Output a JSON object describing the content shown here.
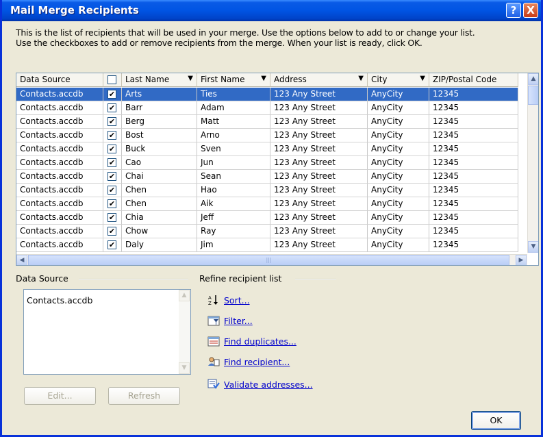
{
  "window": {
    "title": "Mail Merge Recipients",
    "help_label": "?",
    "close_label": "X"
  },
  "intro": {
    "line1": "This is the list of recipients that will be used in your merge.  Use the options below to add to or change your list.",
    "line2": "Use the checkboxes to add or remove recipients from the merge.  When your list is ready, click OK."
  },
  "grid": {
    "columns": [
      "Data Source",
      "",
      "Last Name",
      "First Name",
      "Address",
      "City",
      "ZIP/Postal Code"
    ],
    "rows": [
      {
        "source": "Contacts.accdb",
        "checked": true,
        "last": "Arts",
        "first": "Ties",
        "address": "123 Any Street",
        "city": "AnyCity",
        "zip": "12345",
        "selected": true
      },
      {
        "source": "Contacts.accdb",
        "checked": true,
        "last": "Barr",
        "first": "Adam",
        "address": "123 Any Street",
        "city": "AnyCity",
        "zip": "12345"
      },
      {
        "source": "Contacts.accdb",
        "checked": true,
        "last": "Berg",
        "first": "Matt",
        "address": "123 Any Street",
        "city": "AnyCity",
        "zip": "12345"
      },
      {
        "source": "Contacts.accdb",
        "checked": true,
        "last": "Bost",
        "first": "Arno",
        "address": "123 Any Street",
        "city": "AnyCity",
        "zip": "12345"
      },
      {
        "source": "Contacts.accdb",
        "checked": true,
        "last": "Buck",
        "first": "Sven",
        "address": "123 Any Street",
        "city": "AnyCity",
        "zip": "12345"
      },
      {
        "source": "Contacts.accdb",
        "checked": true,
        "last": "Cao",
        "first": "Jun",
        "address": "123 Any Street",
        "city": "AnyCity",
        "zip": "12345"
      },
      {
        "source": "Contacts.accdb",
        "checked": true,
        "last": "Chai",
        "first": "Sean",
        "address": "123 Any Street",
        "city": "AnyCity",
        "zip": "12345"
      },
      {
        "source": "Contacts.accdb",
        "checked": true,
        "last": "Chen",
        "first": "Hao",
        "address": "123 Any Street",
        "city": "AnyCity",
        "zip": "12345"
      },
      {
        "source": "Contacts.accdb",
        "checked": true,
        "last": "Chen",
        "first": "Aik",
        "address": "123 Any Street",
        "city": "AnyCity",
        "zip": "12345"
      },
      {
        "source": "Contacts.accdb",
        "checked": true,
        "last": "Chia",
        "first": "Jeff",
        "address": "123 Any Street",
        "city": "AnyCity",
        "zip": "12345"
      },
      {
        "source": "Contacts.accdb",
        "checked": true,
        "last": "Chow",
        "first": "Ray",
        "address": "123 Any Street",
        "city": "AnyCity",
        "zip": "12345"
      },
      {
        "source": "Contacts.accdb",
        "checked": true,
        "last": "Daly",
        "first": "Jim",
        "address": "123 Any Street",
        "city": "AnyCity",
        "zip": "12345"
      }
    ]
  },
  "data_source": {
    "group_label": "Data Source",
    "items": [
      "Contacts.accdb"
    ],
    "edit_label": "Edit...",
    "refresh_label": "Refresh"
  },
  "refine": {
    "group_label": "Refine recipient list",
    "sort_label": "Sort...",
    "filter_label": "Filter...",
    "find_duplicates_label": "Find duplicates...",
    "find_recipient_label": "Find recipient...",
    "validate_label": "Validate addresses..."
  },
  "ok_label": "OK",
  "colors": {
    "titlebar": "#0054E3",
    "selection": "#316AC5",
    "dialog_face": "#ECE9D8",
    "link": "#0000CC"
  }
}
